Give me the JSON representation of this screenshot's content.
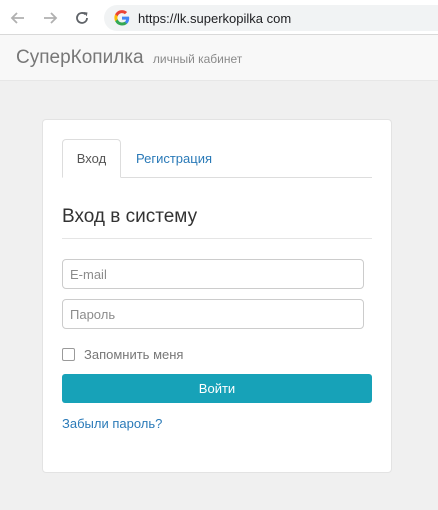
{
  "browser": {
    "url": "https://lk.superkopilka com",
    "icons": {
      "back": "arrow-left-icon",
      "forward": "arrow-right-icon",
      "reload": "reload-icon",
      "site": "google-logo-icon"
    }
  },
  "header": {
    "brand": "СуперКопилка",
    "subtitle": "личный кабинет"
  },
  "login": {
    "tabs": [
      {
        "label": "Вход",
        "active": true
      },
      {
        "label": "Регистрация",
        "active": false
      }
    ],
    "title": "Вход в систему",
    "email": {
      "value": "",
      "placeholder": "E-mail"
    },
    "password": {
      "value": "",
      "placeholder": "Пароль"
    },
    "remember": {
      "label": "Запомнить меня",
      "checked": false
    },
    "submit_label": "Войти",
    "forgot_label": "Забыли пароль?"
  },
  "colors": {
    "accent": "#17a2b8",
    "link": "#2a7ab8",
    "page_background": "#f0f0f0",
    "header_background": "#f8f8f8"
  }
}
